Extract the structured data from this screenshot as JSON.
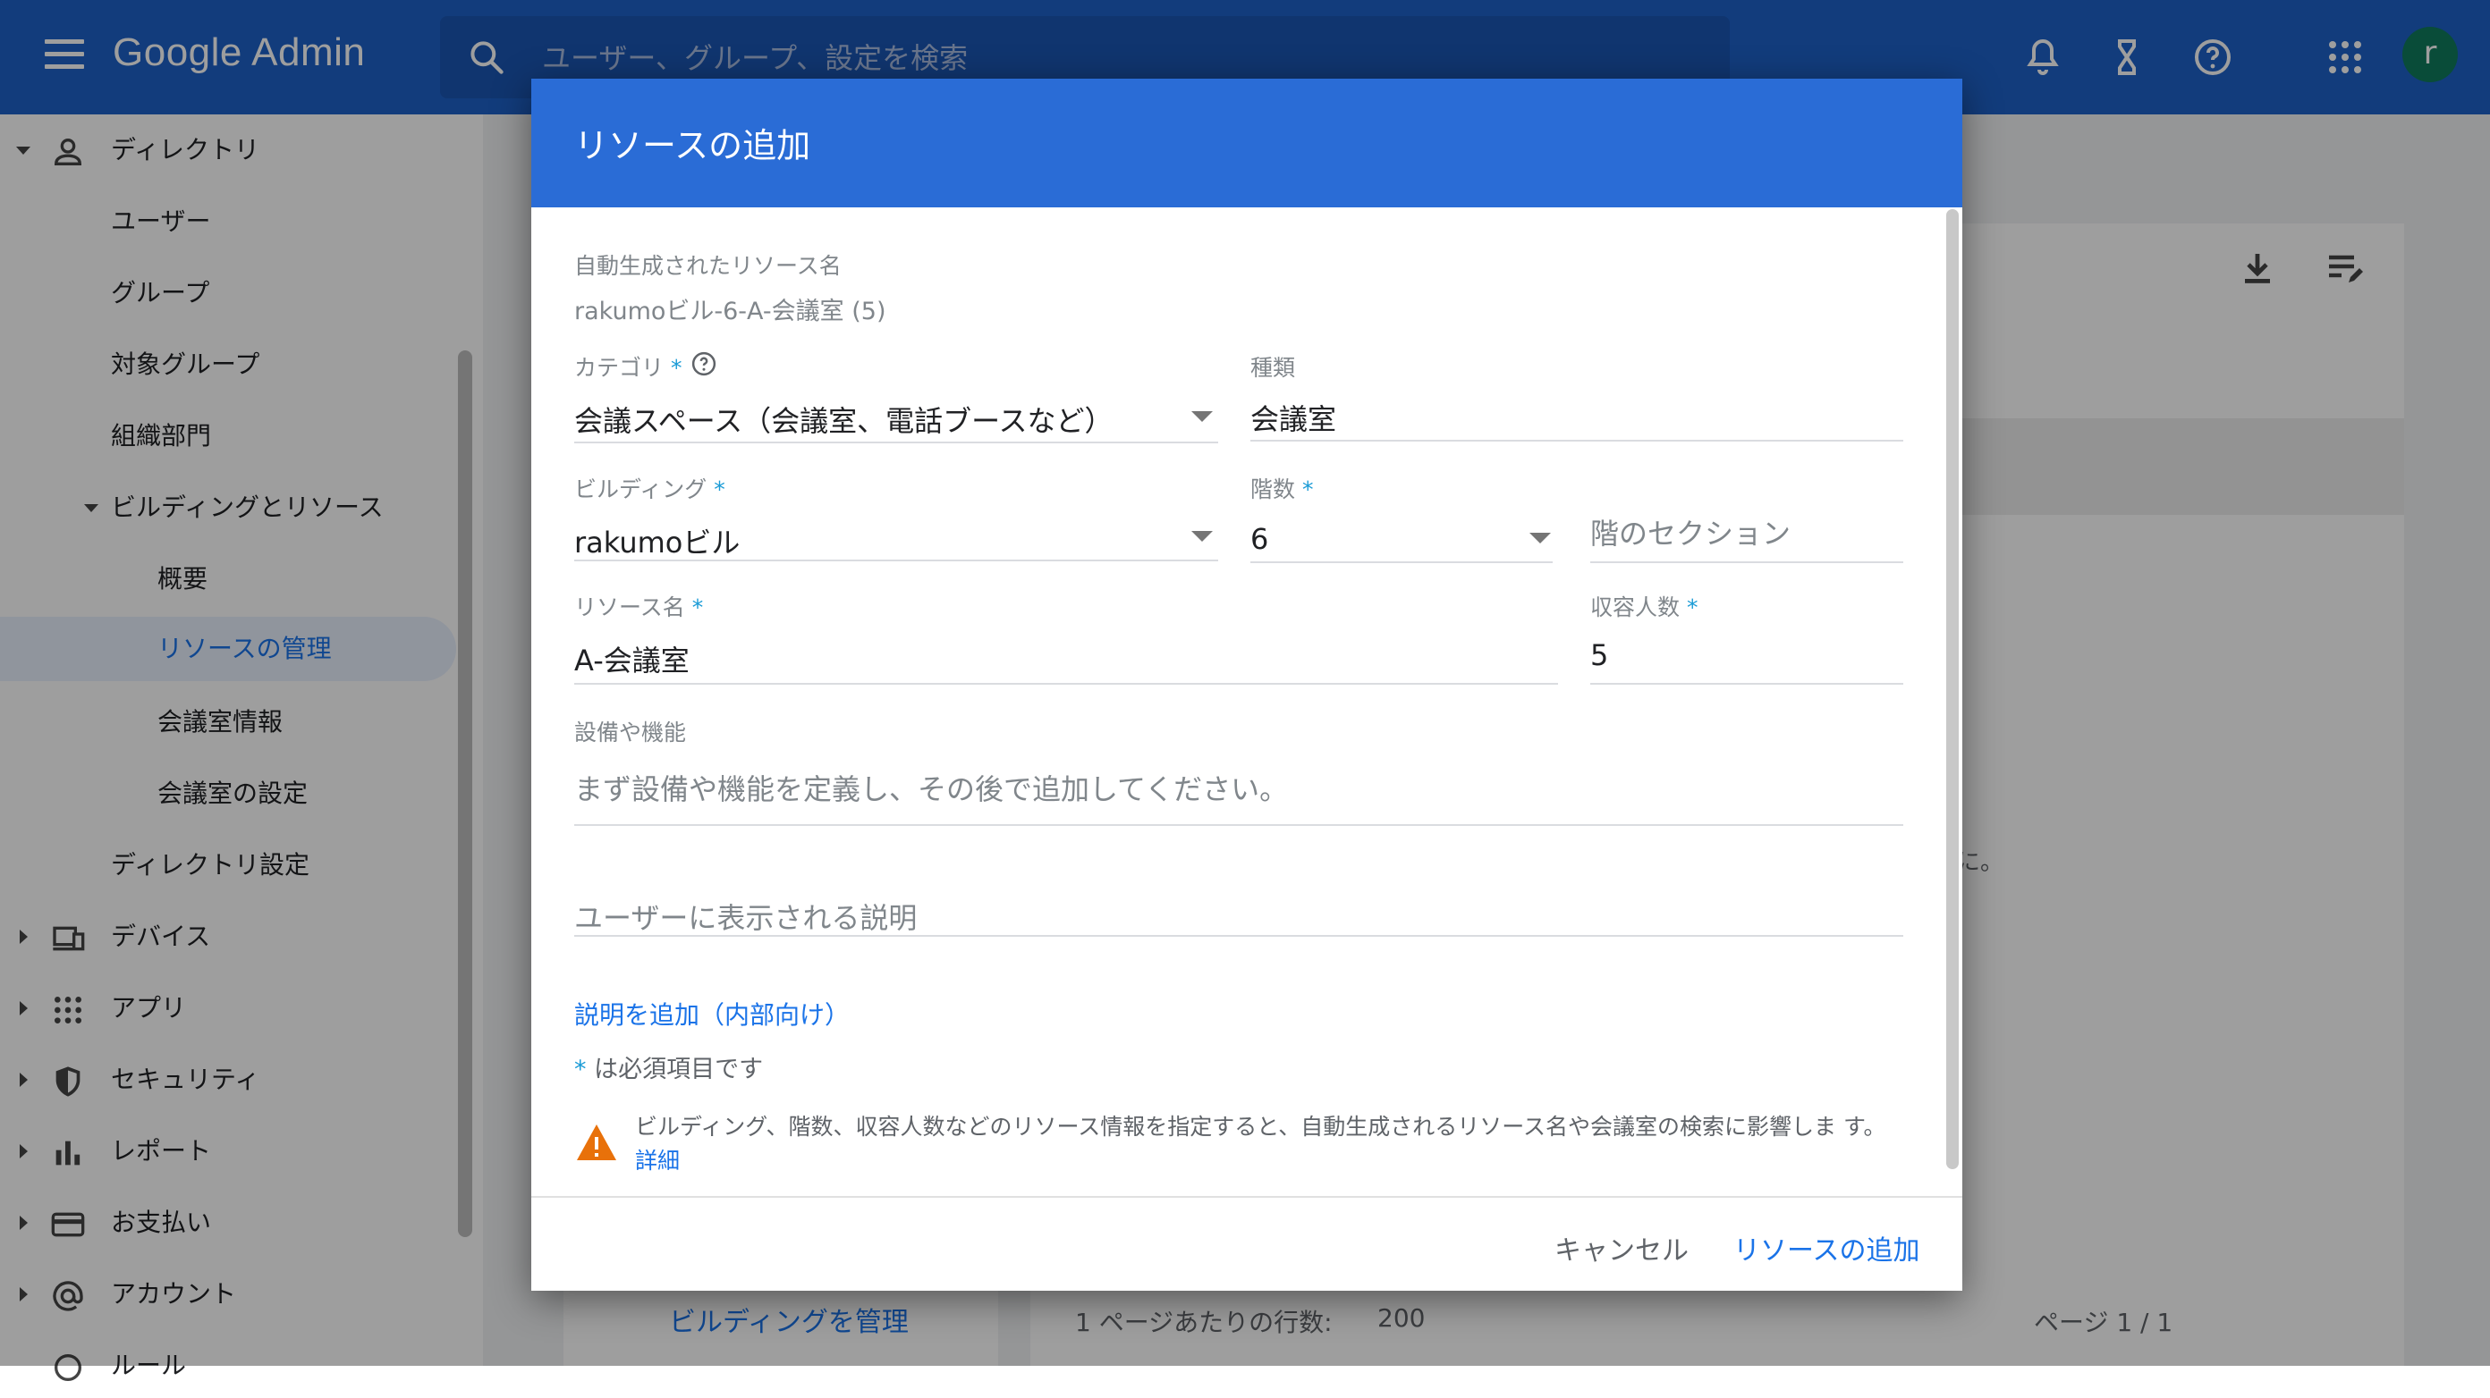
{
  "header": {
    "brand": "Google Admin",
    "search_placeholder": "ユーザー、グループ、設定を検索",
    "avatar_letter": "r",
    "icons": [
      "bell-icon",
      "hourglass-icon",
      "help-icon",
      "apps-grid-icon"
    ]
  },
  "nav": {
    "items": [
      {
        "label": "ディレクトリ"
      },
      {
        "label": "ユーザー"
      },
      {
        "label": "グループ"
      },
      {
        "label": "対象グループ"
      },
      {
        "label": "組織部門"
      },
      {
        "label": "ビルディングとリソース"
      },
      {
        "label": "概要"
      },
      {
        "label": "リソースの管理"
      },
      {
        "label": "会議室情報"
      },
      {
        "label": "会議室の設定"
      },
      {
        "label": "ディレクトリ設定"
      },
      {
        "label": "デバイス"
      },
      {
        "label": "アプリ"
      },
      {
        "label": "セキュリティ"
      },
      {
        "label": "レポート"
      },
      {
        "label": "お支払い"
      },
      {
        "label": "アカウント"
      },
      {
        "label": "ルール"
      }
    ]
  },
  "background": {
    "manage_buildings_link": "ビルディングを管理",
    "rows_per_page_label": "1 ページあたりの行数:",
    "rows_per_page_value": "200",
    "pagination": "ページ 1 / 1",
    "trailing_text": "に。"
  },
  "dialog": {
    "title": "リソースの追加",
    "auto_name_label": "自動生成されたリソース名",
    "auto_name_value": "rakumoビル-6-A-会議室 (5)",
    "category_label": "カテゴリ",
    "category_value": "会議スペース（会議室、電話ブースなど）",
    "type_label": "種類",
    "type_value": "会議室",
    "building_label": "ビルディング",
    "building_value": "rakumoビル",
    "floor_label": "階数",
    "floor_value": "6",
    "floor_section_placeholder": "階のセクション",
    "resource_name_label": "リソース名",
    "resource_name_value": "A-会議室",
    "capacity_label": "収容人数",
    "capacity_value": "5",
    "features_label": "設備や機能",
    "features_placeholder": "まず設備や機能を定義し、その後で追加してください。",
    "user_description_placeholder": "ユーザーに表示される説明",
    "add_internal_description": "説明を追加（内部向け）",
    "required_star": "*",
    "required_note": " は必須項目です",
    "warning_text": "ビルディング、階数、収容人数などのリソース情報を指定すると、自動生成されるリソース名や会議室の検索に影響しま す。",
    "warning_link": "詳細",
    "cancel_label": "キャンセル",
    "add_label": "リソースの追加"
  },
  "colors": {
    "header_bg": "#1e61c8",
    "dialog_header_bg": "#2a6cd6",
    "link": "#1a73e8",
    "required": "#1a9bd6",
    "warning": "#e8710a"
  }
}
